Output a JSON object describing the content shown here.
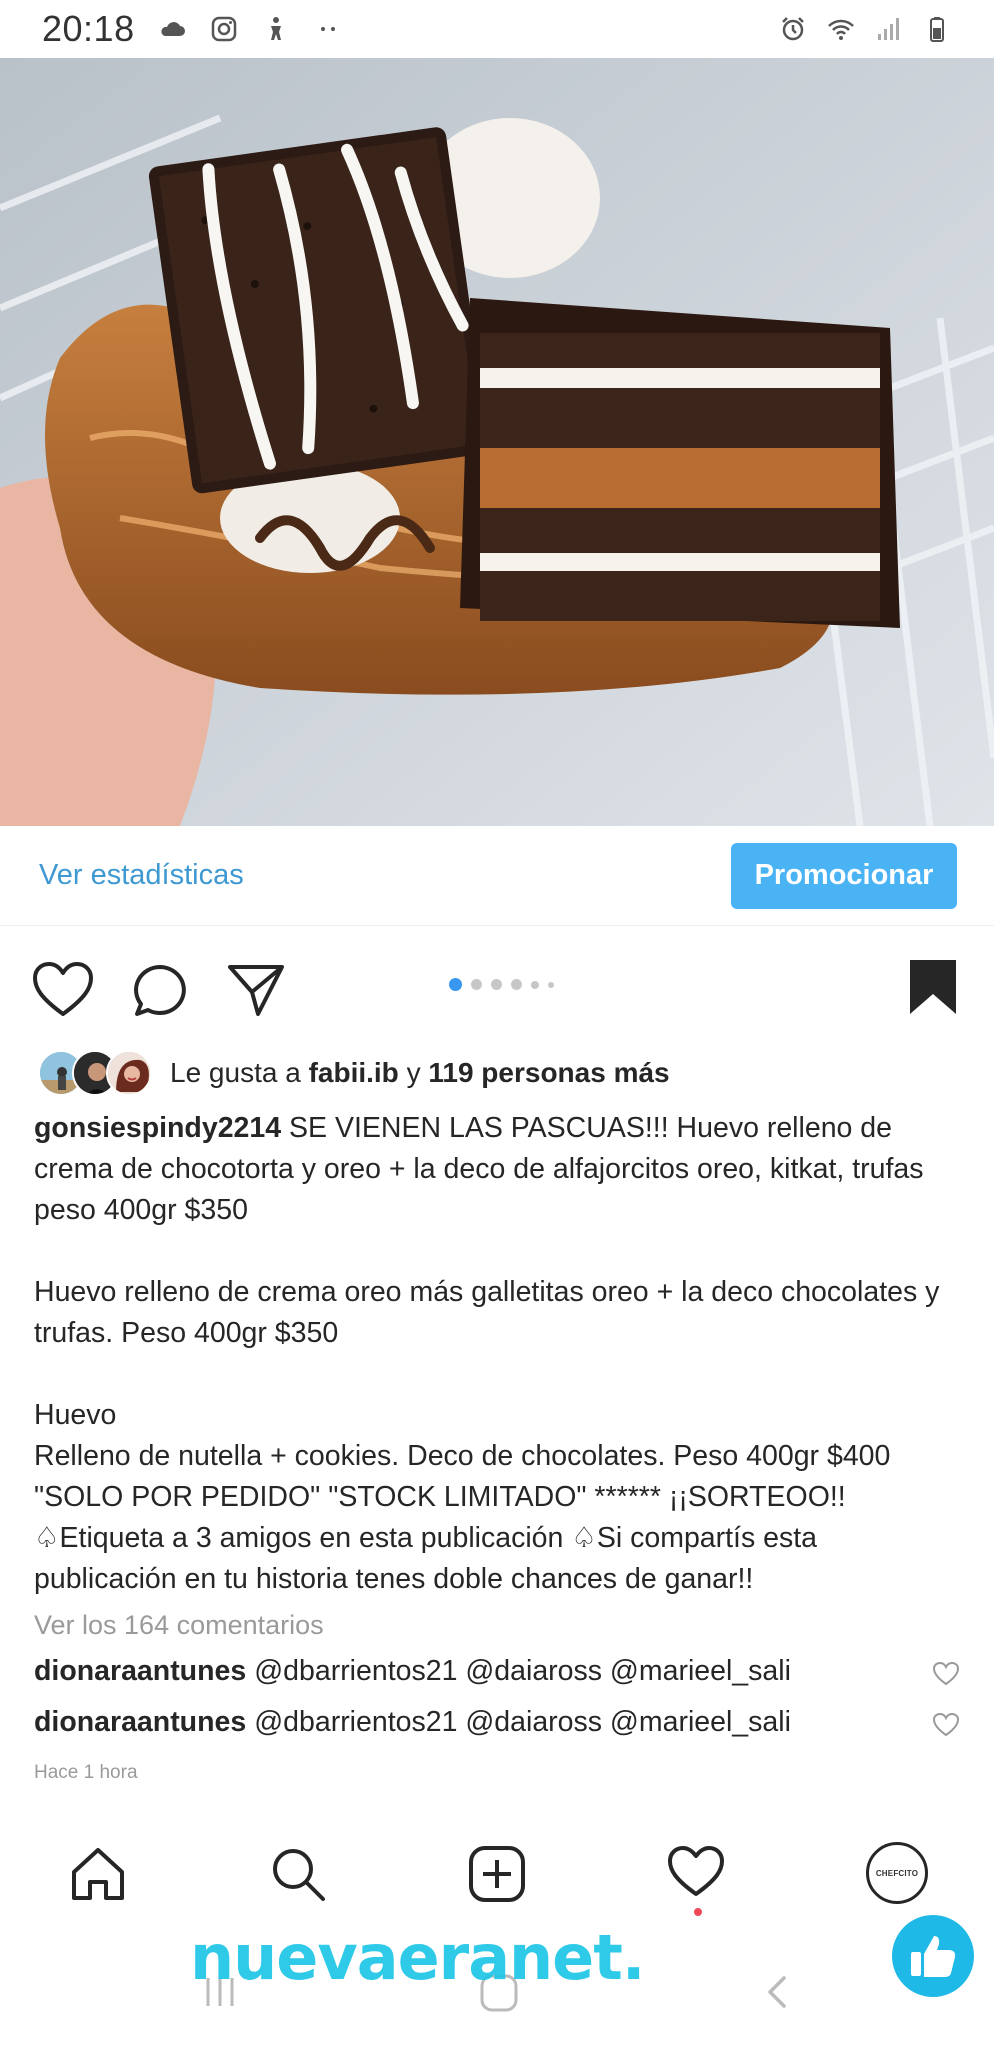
{
  "status_bar": {
    "time": "20:18",
    "left_icons": [
      "cloud-icon",
      "instagram-icon",
      "accessibility-icon",
      "more-dots-icon"
    ],
    "right_icons": [
      "alarm-icon",
      "wifi-icon",
      "signal-icon",
      "battery-icon"
    ]
  },
  "post": {
    "image_description_icon": "chocolate-egg-photo",
    "insights_label": "Ver estadísticas",
    "promote_label": "Promocionar",
    "carousel": {
      "count": 6,
      "active_index": 0
    },
    "likes": {
      "prefix": "Le gusta a ",
      "user": "fabii.ib",
      "middle": " y ",
      "others": "119 personas más"
    },
    "caption": {
      "username": "gonsiespindy2214",
      "paragraphs": [
        "SE VIENEN LAS PASCUAS!!! Huevo relleno de crema de chocotorta y oreo + la deco de alfajorcitos oreo, kitkat, trufas peso 400gr $350",
        "Huevo relleno de crema oreo más galletitas oreo + la deco chocolates y trufas. Peso 400gr $350",
        "Huevo",
        "Relleno de nutella + cookies. Deco de chocolates. Peso 400gr $400 \"SOLO POR PEDIDO\" \"STOCK LIMITADO\" ****** ¡¡SORTEOO!! ♤Etiqueta a 3 amigos en esta publicación ♤Si compartís esta publicación en tu historia tenes doble chances de ganar!!"
      ]
    },
    "view_comments": "Ver los 164 comentarios",
    "comments": [
      {
        "user": "dionaraantunes",
        "text": "@dbarrientos21 @daiaross @marieel_sali"
      },
      {
        "user": "dionaraantunes",
        "text": "@dbarrientos21 @daiaross @marieel_sali"
      }
    ],
    "timestamp": "Hace 1 hora"
  },
  "bottom_nav": {
    "items": [
      "home-icon",
      "search-icon",
      "add-post-icon",
      "activity-heart-icon",
      "profile-avatar"
    ],
    "profile_text": "CHEFCITO"
  },
  "watermark": "nuevaeranet.",
  "colors": {
    "accent_blue": "#3897f0",
    "promote_button": "#4ab3f4",
    "link_blue": "#3e99d2",
    "watermark": "#1fc6e8"
  }
}
